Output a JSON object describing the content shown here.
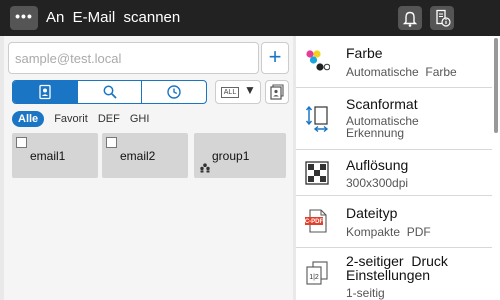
{
  "header": {
    "menu_label": "•••",
    "title": "An  E-Mail  scannen"
  },
  "address": {
    "placeholder": "sample@test.local",
    "add_label": "+"
  },
  "search_tabs": [
    "address-book",
    "search",
    "history"
  ],
  "filter_dropdown": {
    "label": "ALL",
    "arrow": "▼"
  },
  "filters": [
    "Alle",
    "Favorit",
    "DEF",
    "GHI"
  ],
  "destinations": [
    {
      "label": "email1",
      "type": "email"
    },
    {
      "label": "email2",
      "type": "email"
    },
    {
      "label": "group1",
      "type": "group"
    }
  ],
  "settings": [
    {
      "name": "Farbe",
      "value": "Automatische  Farbe",
      "icon": "color-icon"
    },
    {
      "name": "Scanformat",
      "value": "Automatische\nErkennung",
      "icon": "scan-size-icon"
    },
    {
      "name": "Auflösung",
      "value": "300x300dpi",
      "icon": "resolution-icon"
    },
    {
      "name": "Dateityp",
      "value": "Kompakte  PDF",
      "icon": "file-type-icon"
    },
    {
      "name": "2-seitiger  Druck\nEinstellungen",
      "value": "1-seitig",
      "icon": "duplex-icon"
    }
  ],
  "colors": {
    "accent": "#1a76c4",
    "titlebar": "#222222"
  }
}
